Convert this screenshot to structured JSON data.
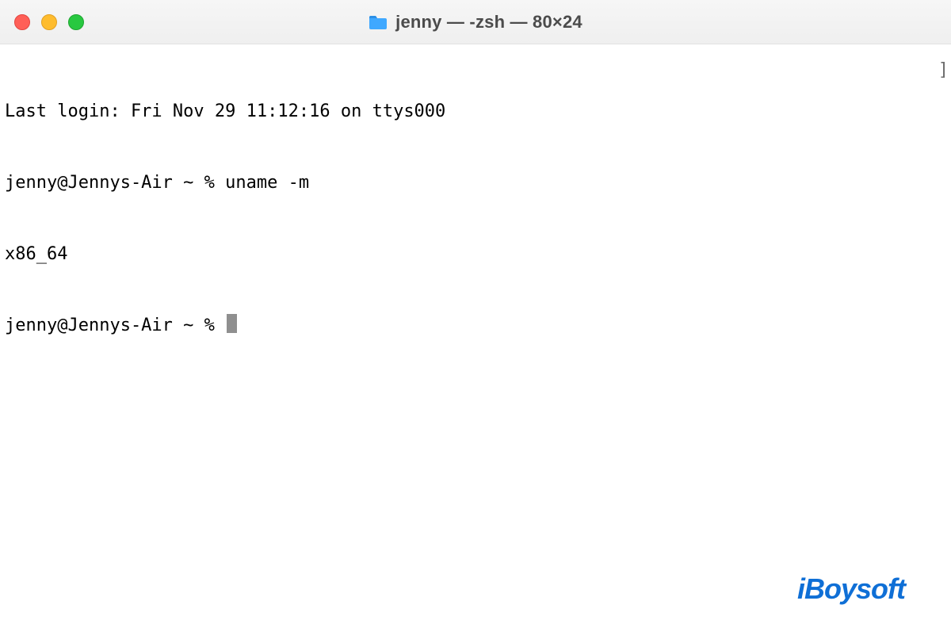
{
  "window": {
    "title": "jenny — -zsh — 80×24"
  },
  "terminal": {
    "lines": {
      "last_login": "Last login: Fri Nov 29 11:12:16 on ttys000",
      "prompt1": "jenny@Jennys-Air ~ % uname -m",
      "output1": "x86_64",
      "prompt2": "jenny@Jennys-Air ~ % "
    },
    "scroll_mark": "]"
  },
  "watermark": {
    "text": "iBoysoft"
  }
}
